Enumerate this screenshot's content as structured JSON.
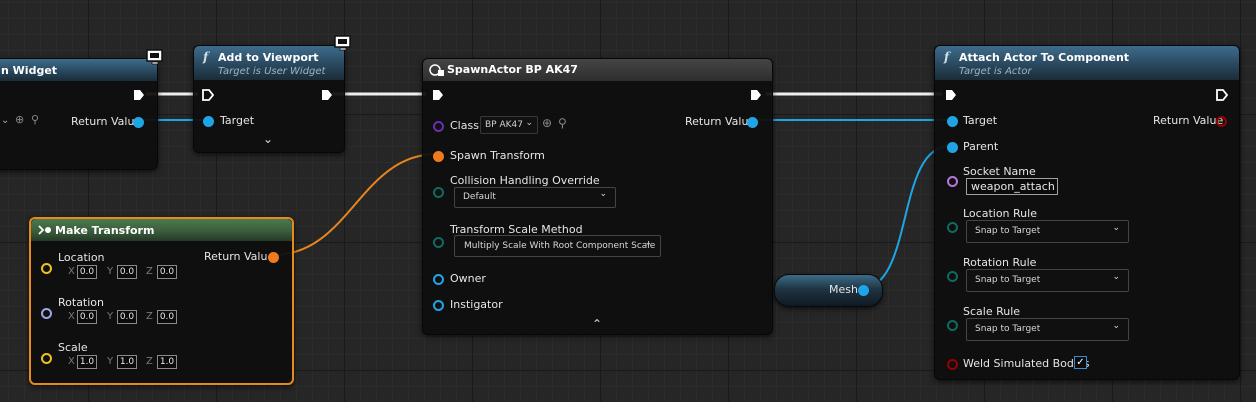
{
  "nodes": {
    "create_widget": {
      "title": "n Widget",
      "return_label": "Return Value"
    },
    "add_to_viewport": {
      "title": "Add to Viewport",
      "subtitle": "Target is User Widget",
      "target_label": "Target"
    },
    "spawn_actor": {
      "title": "SpawnActor BP AK47",
      "class_label": "Class",
      "class_value": "BP AK47",
      "spawn_transform_label": "Spawn Transform",
      "collision_label": "Collision Handling Override",
      "collision_value": "Default",
      "scale_method_label": "Transform Scale Method",
      "scale_method_value": "Multiply Scale With Root Component Scale",
      "owner_label": "Owner",
      "instigator_label": "Instigator",
      "return_label": "Return Value"
    },
    "make_transform": {
      "title": "Make Transform",
      "return_label": "Return Value",
      "location": {
        "label": "Location",
        "x": "0.0",
        "y": "0.0",
        "z": "0.0"
      },
      "rotation": {
        "label": "Rotation",
        "x": "0.0",
        "y": "0.0",
        "z": "0.0"
      },
      "scale": {
        "label": "Scale",
        "x": "1.0",
        "y": "1.0",
        "z": "1.0"
      },
      "axis_x": "X",
      "axis_y": "Y",
      "axis_z": "Z"
    },
    "mesh": {
      "label": "Mesh"
    },
    "attach_actor": {
      "title": "Attach Actor To Component",
      "subtitle": "Target is Actor",
      "target_label": "Target",
      "parent_label": "Parent",
      "return_label": "Return Value",
      "socket_label": "Socket Name",
      "socket_value": "weapon_attach",
      "location_rule_label": "Location Rule",
      "location_rule_value": "Snap to Target",
      "rotation_rule_label": "Rotation Rule",
      "rotation_rule_value": "Snap to Target",
      "scale_rule_label": "Scale Rule",
      "scale_rule_value": "Snap to Target",
      "weld_label": "Weld Simulated Bodies",
      "weld_checked": true
    }
  },
  "icons": {
    "function": "f",
    "dropdown_chevron": "⌄",
    "checkmark": "✓",
    "collapse_up": "⌃",
    "expand_down": "⌄"
  },
  "colors": {
    "object_pin": "#1fa5e6",
    "struct_pin": "#f07a1e",
    "class_pin": "#6a2fb0",
    "name_pin": "#b576d8",
    "enum_pin": "#0e6a62",
    "vector_pin": "#f0c020",
    "rotator_pin": "#9aa8e8",
    "bool_pin": "#990000",
    "selection_outline": "#e8891e"
  }
}
